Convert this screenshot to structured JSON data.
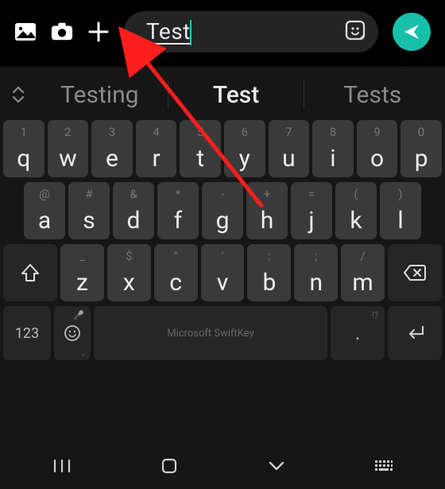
{
  "input": {
    "value": "Test"
  },
  "suggestions": {
    "left": "Testing",
    "center": "Test",
    "right": "Tests"
  },
  "rows": {
    "r1": [
      {
        "main": "q",
        "alt": "1"
      },
      {
        "main": "w",
        "alt": "2"
      },
      {
        "main": "e",
        "alt": "3"
      },
      {
        "main": "r",
        "alt": "4"
      },
      {
        "main": "t",
        "alt": "5"
      },
      {
        "main": "y",
        "alt": "6"
      },
      {
        "main": "u",
        "alt": "7"
      },
      {
        "main": "i",
        "alt": "8"
      },
      {
        "main": "o",
        "alt": "9"
      },
      {
        "main": "p",
        "alt": "0"
      }
    ],
    "r2": [
      {
        "main": "a",
        "alt": "@"
      },
      {
        "main": "s",
        "alt": "#"
      },
      {
        "main": "d",
        "alt": "&"
      },
      {
        "main": "f",
        "alt": "*"
      },
      {
        "main": "g",
        "alt": "-"
      },
      {
        "main": "h",
        "alt": "+"
      },
      {
        "main": "j",
        "alt": "="
      },
      {
        "main": "k",
        "alt": "("
      },
      {
        "main": "l",
        "alt": ")"
      }
    ],
    "r3": [
      {
        "main": "z",
        "alt": "_"
      },
      {
        "main": "x",
        "alt": "$"
      },
      {
        "main": "c",
        "alt": "\""
      },
      {
        "main": "v",
        "alt": "'"
      },
      {
        "main": "b",
        "alt": ":"
      },
      {
        "main": "n",
        "alt": ";"
      },
      {
        "main": "m",
        "alt": "/"
      }
    ]
  },
  "bottom": {
    "sym": "123",
    "space": "Microsoft SwiftKey",
    "punct_main": ".",
    "punct_alt": "!?",
    "comma": ","
  },
  "colors": {
    "accent": "#18bfa9"
  }
}
